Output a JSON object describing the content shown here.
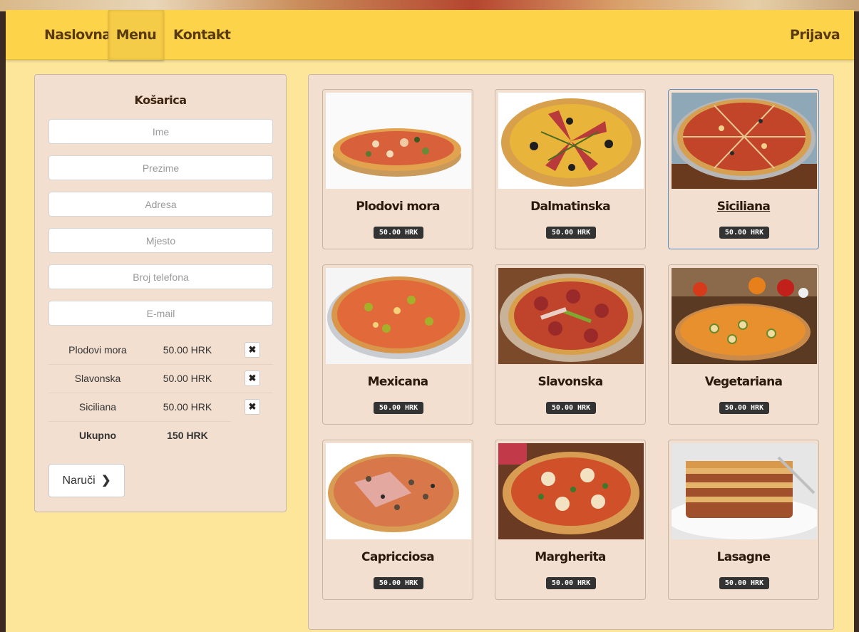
{
  "nav": {
    "items": [
      {
        "label": "Naslovna"
      },
      {
        "label": "Menu"
      },
      {
        "label": "Kontakt"
      }
    ],
    "login": "Prijava"
  },
  "cart": {
    "title": "Košarica",
    "fields": [
      {
        "placeholder": "Ime",
        "value": ""
      },
      {
        "placeholder": "Prezime",
        "value": ""
      },
      {
        "placeholder": "Adresa",
        "value": ""
      },
      {
        "placeholder": "Mjesto",
        "value": ""
      },
      {
        "placeholder": "Broj telefona",
        "value": ""
      },
      {
        "placeholder": "E-mail",
        "value": ""
      }
    ],
    "items": [
      {
        "name": "Plodovi mora",
        "price": "50.00 HRK",
        "remove_icon": "times-icon"
      },
      {
        "name": "Slavonska",
        "price": "50.00 HRK",
        "remove_icon": "times-icon"
      },
      {
        "name": "Siciliana",
        "price": "50.00 HRK",
        "remove_icon": "times-icon"
      }
    ],
    "total_label": "Ukupno",
    "total_value": "150 HRK",
    "order_label": "Naruči",
    "order_icon": "chevron-right-icon"
  },
  "menu": {
    "items": [
      {
        "name": "Plodovi mora",
        "price": "50.00 HRK",
        "image": "seafood-pizza"
      },
      {
        "name": "Dalmatinska",
        "price": "50.00 HRK",
        "image": "dalmatian-pizza"
      },
      {
        "name": "Siciliana",
        "price": "50.00 HRK",
        "image": "sicilian-pizza"
      },
      {
        "name": "Mexicana",
        "price": "50.00 HRK",
        "image": "mexican-pizza"
      },
      {
        "name": "Slavonska",
        "price": "50.00 HRK",
        "image": "slavonian-pizza"
      },
      {
        "name": "Vegetariana",
        "price": "50.00 HRK",
        "image": "vegetarian-pizza"
      },
      {
        "name": "Capricciosa",
        "price": "50.00 HRK",
        "image": "capricciosa-pizza"
      },
      {
        "name": "Margherita",
        "price": "50.00 HRK",
        "image": "margherita-pizza"
      },
      {
        "name": "Lasagne",
        "price": "50.00 HRK",
        "image": "lasagne-dish"
      }
    ]
  },
  "colors": {
    "navbar": "#fdd449",
    "page_bg": "#fde59a",
    "panel_bg": "#f2dfd0",
    "badge_bg": "#333333",
    "brand_text": "#5a3a12"
  }
}
